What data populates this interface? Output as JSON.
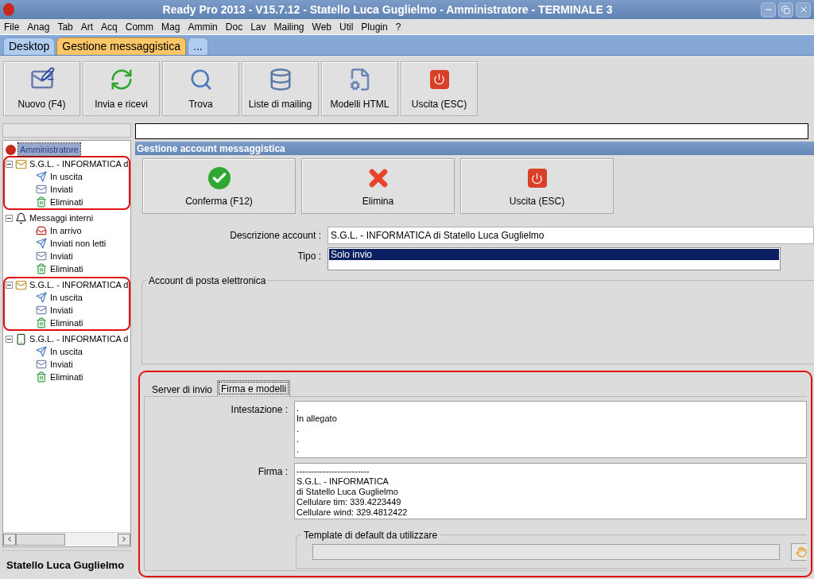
{
  "window": {
    "title": "Ready Pro 2013 - V15.7.12 - Statello Luca Guglielmo - Amministratore - TERMINALE 3"
  },
  "menu": [
    "File",
    "Anag",
    "Tab",
    "Art",
    "Acq",
    "Comm",
    "Mag",
    "Ammin",
    "Doc",
    "Lav",
    "Mailing",
    "Web",
    "Util",
    "Plugin",
    "?"
  ],
  "tabs": [
    {
      "label": "Desktop",
      "selected": false
    },
    {
      "label": "Gestione messaggistica",
      "selected": true
    },
    {
      "label": "...",
      "selected": false
    }
  ],
  "toolbar": [
    {
      "kind": "new",
      "label": "Nuovo (F4)"
    },
    {
      "kind": "sync",
      "label": "Invia e ricevi"
    },
    {
      "kind": "find",
      "label": "Trova"
    },
    {
      "kind": "lists",
      "label": "Liste di mailing"
    },
    {
      "kind": "templates",
      "label": "Modelli HTML"
    },
    {
      "kind": "exit",
      "label": "Uscita (ESC)"
    }
  ],
  "tree": {
    "root": "Amministratore",
    "root_selected": true,
    "children": [
      {
        "kind": "account",
        "label": "S.G.L. - INFORMATICA d",
        "expanded": true,
        "highlighted": true,
        "children": [
          {
            "kind": "outbox",
            "label": "In uscita"
          },
          {
            "kind": "sent",
            "label": "Inviati"
          },
          {
            "kind": "deleted",
            "label": "Eliminati"
          }
        ]
      },
      {
        "kind": "internal",
        "label": "Messaggi interni",
        "expanded": true,
        "highlighted": false,
        "children": [
          {
            "kind": "inbox",
            "label": "In arrivo"
          },
          {
            "kind": "outbox",
            "label": "Inviati non letti"
          },
          {
            "kind": "sent",
            "label": "Inviati"
          },
          {
            "kind": "deleted",
            "label": "Eliminati"
          }
        ]
      },
      {
        "kind": "account",
        "label": "S.G.L. - INFORMATICA d",
        "expanded": true,
        "highlighted": true,
        "children": [
          {
            "kind": "outbox",
            "label": "In uscita"
          },
          {
            "kind": "sent",
            "label": "Inviati"
          },
          {
            "kind": "deleted",
            "label": "Eliminati"
          }
        ]
      },
      {
        "kind": "phone",
        "label": "S.G.L. - INFORMATICA d",
        "expanded": true,
        "highlighted": false,
        "children": [
          {
            "kind": "outbox",
            "label": "In uscita"
          },
          {
            "kind": "sent",
            "label": "Inviati"
          },
          {
            "kind": "deleted",
            "label": "Eliminati"
          }
        ]
      }
    ]
  },
  "status_bar": "Statello Luca Guglielmo",
  "panel": {
    "title": "Gestione account messaggistica",
    "buttons": [
      {
        "kind": "confirm",
        "label": "Conferma (F12)"
      },
      {
        "kind": "delete",
        "label": "Elimina"
      },
      {
        "kind": "exit",
        "label": "Uscita (ESC)"
      }
    ],
    "description": {
      "label": "Descrizione account :",
      "value": "S.G.L. - INFORMATICA di Statello Luca Guglielmo"
    },
    "type": {
      "label": "Tipo :",
      "options": [
        {
          "label": "Solo invio",
          "selected": true
        }
      ]
    },
    "group_title": "Account di posta elettronica",
    "highlighted": true,
    "subtabs": [
      {
        "label": "Server di invio",
        "selected": false
      },
      {
        "label": "Firma e modelli",
        "selected": true
      }
    ],
    "header": {
      "label": "Intestazione :",
      "lines": [
        ".",
        "In allegato",
        ".",
        ".",
        "."
      ]
    },
    "signature": {
      "label": "Firma :",
      "lines": [
        "-------------------------",
        "S.G.L. - INFORMATICA",
        "di Statello Luca Guglielmo",
        "Cellulare tim: 339.4223449",
        "Cellulare wind: 329.4812422"
      ]
    },
    "template_group": "Template di default da utilizzare"
  }
}
